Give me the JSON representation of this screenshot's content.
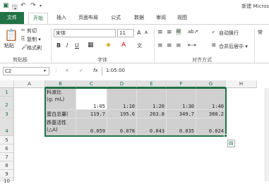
{
  "titlebar": {
    "title": "新建 Micros"
  },
  "tabs": [
    "文件",
    "开始",
    "插入",
    "页面布局",
    "公式",
    "数据",
    "审阅",
    "视图"
  ],
  "clipboard": {
    "paste": "粘贴",
    "cut": "剪切",
    "copy": "复制 ▾",
    "format_painter": "格式刷",
    "group_label": "剪贴板"
  },
  "font": {
    "name": "宋体",
    "size": "11",
    "bold": "B",
    "italic": "I",
    "underline": "U",
    "grow": "A",
    "shrink": "A",
    "group_label": "字体"
  },
  "alignment": {
    "wrap": "自动换行",
    "merge": "合并后居中 ▾",
    "group_label": "对齐方式"
  },
  "formula_bar": {
    "name_box": "C2",
    "cancel": "×",
    "enter": "✓",
    "fx": "fx",
    "content": "1:05:00"
  },
  "columns": [
    "A",
    "B",
    "C",
    "D",
    "E",
    "F",
    "G",
    "H"
  ],
  "rows": [
    "1",
    "2",
    "3",
    "4",
    "5",
    "6",
    "7",
    "8",
    "9",
    "10",
    "11"
  ],
  "table": {
    "row_labels": [
      "料液比\n(g: mL)",
      "蛋白总量(",
      "跌基活性\n(△A)"
    ],
    "ratios": [
      "1:05",
      "1:10",
      "1:20",
      "1:30",
      "1:40"
    ],
    "protein": [
      "119.7",
      "195.6",
      "263.8",
      "349.7",
      "380.2"
    ],
    "activity": [
      "0.059",
      "0.078",
      "0.043",
      "0.035",
      "0.024"
    ]
  }
}
